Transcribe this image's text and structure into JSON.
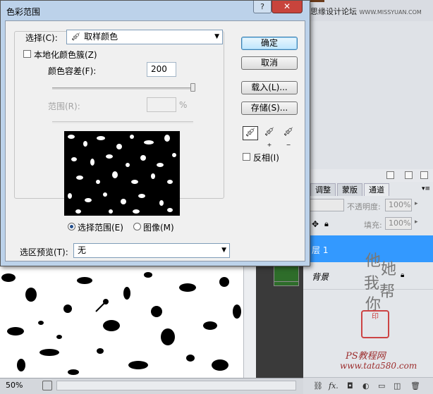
{
  "dialog": {
    "title": "色彩范围",
    "help_label": "?",
    "close_label": "✕"
  },
  "select": {
    "label": "选择(C):",
    "value": "取样颜色",
    "icon": "eyedropper-icon"
  },
  "localized": {
    "label": "本地化颜色簇(Z)",
    "checked": false
  },
  "fuzziness": {
    "label": "颜色容差(F):",
    "value": "200"
  },
  "range": {
    "label": "范围(R):",
    "value": "",
    "unit": "%"
  },
  "preview_mode": {
    "options": [
      "选择范围(E)",
      "图像(M)"
    ],
    "selected": "选择范围(E)"
  },
  "selection_preview": {
    "label": "选区预览(T):",
    "value": "无"
  },
  "buttons": {
    "ok": "确定",
    "cancel": "取消",
    "load": "载入(L)...",
    "save": "存储(S)..."
  },
  "tools": [
    "eyedropper-icon",
    "eyedropper-plus-icon",
    "eyedropper-minus-icon"
  ],
  "invert": {
    "label": "反相(I)",
    "checked": false
  },
  "workspace": {
    "site_title": "思缘设计论坛",
    "site_url": "WWW.MISSYUAN.COM",
    "panel_tabs": [
      "调整",
      "蒙版",
      "通道"
    ],
    "opacity_label": "不透明度:",
    "opacity_value": "100%",
    "fill_label": "填充:",
    "fill_value": "100%",
    "layers": [
      {
        "name": "层 1",
        "selected": true
      },
      {
        "name": "背景",
        "selected": false
      }
    ],
    "zoom": "50%",
    "calligraphy": [
      "他",
      "她",
      "我",
      "帮",
      "你"
    ],
    "seal_text": "印",
    "watermark": "PS教程网",
    "watermark_url": "www.tata580.com"
  },
  "colors": {
    "titlebar": "#bcd2ea",
    "close_button": "#c8443c",
    "selected_layer": "#3399ff"
  }
}
